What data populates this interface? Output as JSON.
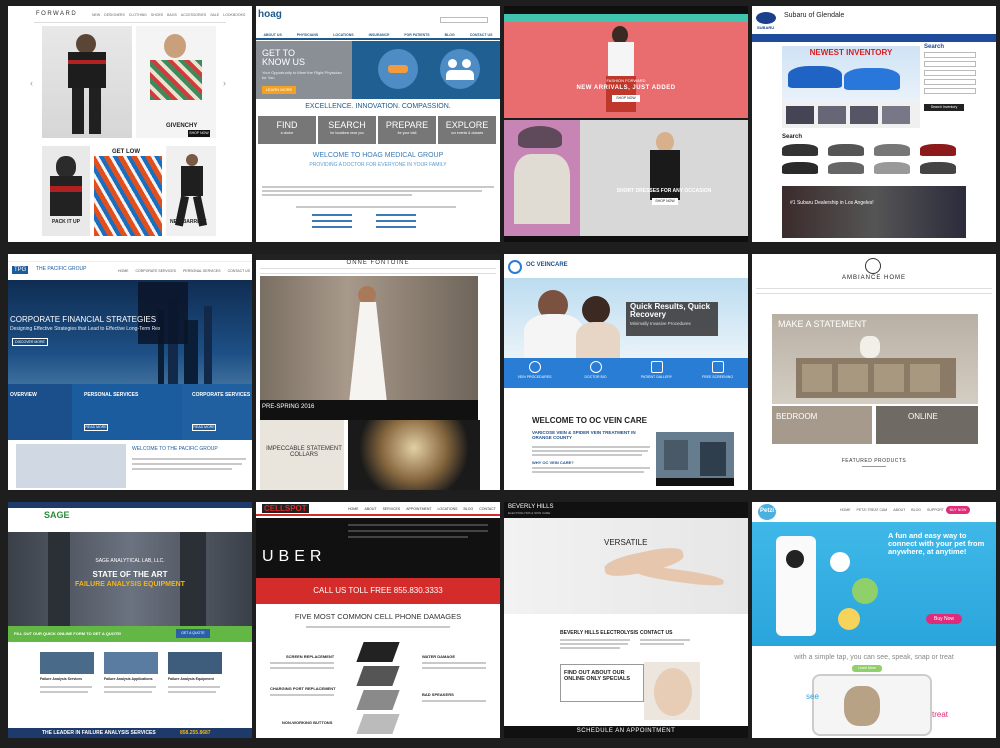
{
  "tiles": {
    "forward": {
      "logo": "FORWARD",
      "nav": [
        "NEW",
        "DESIGNERS",
        "CLOTHING",
        "SHOES",
        "BAGS",
        "ACCESSORIES",
        "SALE",
        "LOOKBOOKS"
      ],
      "hero_brand": "GIVENCHY",
      "hero_button": "SHOP NOW",
      "get_low": "GET LOW",
      "pack_it_up": "PACK IT UP",
      "neil_barrett": "NEIL BARRETT"
    },
    "hoag": {
      "logo": "hoag",
      "nav": [
        "ABOUT US",
        "PHYSICIANS",
        "LOCATIONS",
        "INSURANCE",
        "FOR PATIENTS",
        "BLOG",
        "CONTACT US"
      ],
      "hero_title": "GET TO KNOW US",
      "hero_sub": "Your Opportunity to Meet the Right Physician for You",
      "learn_more": "LEARN MORE",
      "tagline": "EXCELLENCE. INNOVATION. COMPASSION.",
      "boxes": [
        {
          "title": "FIND",
          "sub": "a doctor"
        },
        {
          "title": "SEARCH",
          "sub": "for locations near you"
        },
        {
          "title": "PREPARE",
          "sub": "for your visit"
        },
        {
          "title": "EXPLORE",
          "sub": "our events & classes"
        }
      ],
      "welcome": "WELCOME TO HOAG MEDICAL GROUP",
      "welcome_sub": "PROVIDING A DOCTOR FOR EVERYONE IN YOUR FAMILY"
    },
    "fashion": {
      "hero_kicker": "FASHION FORWARD",
      "hero_title": "NEW ARRIVALS, JUST ADDED",
      "shop_now": "SHOP NOW",
      "dresses": "SHORT DRESSES FOR ANY OCCASION",
      "shop_now_2": "SHOP NOW"
    },
    "subaru": {
      "brand": "SUBARU",
      "dealer": "Subaru of Glendale",
      "banner": "NEWEST INVENTORY",
      "search_title": "Search",
      "search_label": "Search",
      "search_button": "Search Inventory",
      "promo": "#1 Subaru Dealership in Los Angeles!"
    },
    "pacific": {
      "logo_mark": "TPG",
      "logo_text": "THE PACIFIC GROUP",
      "nav": [
        "HOME",
        "CORPORATE SERVICES",
        "PERSONAL SERVICES",
        "CONTACT US"
      ],
      "hero_title": "CORPORATE FINANCIAL STRATEGIES",
      "hero_sub": "Designing Effective Strategies that Lead to Effective Long-Term Results",
      "discover": "DISCOVER MORE",
      "col1": "OVERVIEW",
      "col2": "PERSONAL SERVICES",
      "col3": "CORPORATE SERVICES",
      "read_more": "READ MORE",
      "welcome": "WELCOME TO THE PACIFIC GROUP"
    },
    "onne": {
      "logo": "ONNE FONTOINE",
      "season": "PRE-SPRING 2016",
      "collars": "IMPECCABLE STATEMENT COLLARS"
    },
    "ocvein": {
      "logo": "OC VEINCARE",
      "hero_title": "Quick Results, Quick Recovery",
      "hero_sub": "Minimally Invasive Procedures",
      "features": [
        "VEIN PROCEDURES",
        "DOCTOR BIO",
        "PATIENT GALLERY",
        "FREE SCREENING"
      ],
      "welcome": "WELCOME TO OC VEIN CARE",
      "sub": "VARICOSE VEIN & SPIDER VEIN TREATMENT IN ORANGE COUNTY",
      "why": "WHY OC VEIN CARE?"
    },
    "ambiance": {
      "logo": "AMBIANCE HOME",
      "hero": "MAKE A STATEMENT",
      "bedroom": "BEDROOM",
      "online": "ONLINE",
      "featured": "FEATURED PRODUCTS"
    },
    "sage": {
      "logo": "SAGE",
      "hero_lab": "SAGE ANALYTICAL LAB, LLC.",
      "hero_title": "STATE OF THE ART",
      "hero_sub": "FAILURE ANALYSIS EQUIPMENT",
      "quote_bar": "FILL OUT OUR QUICK ONLINE FORM TO GET A QUOTE!",
      "quote_btn": "GET A QUOTE",
      "cards": [
        "Failure Analysis Services",
        "Failure Analysis Applications",
        "Failure Analysis Equipment"
      ],
      "footer": "THE LEADER IN FAILURE ANALYSIS SERVICES",
      "phone": "858.255.8687"
    },
    "cellspot": {
      "logo": "CELLSPOT",
      "nav": [
        "HOME",
        "ABOUT",
        "SERVICES",
        "APPOINTMENT",
        "LOCATIONS",
        "BLOG",
        "CONTACT"
      ],
      "uber": "UBER",
      "call": "CALL US TOLL FREE 855.830.3333",
      "damages": "FIVE MOST COMMON CELL PHONE DAMAGES",
      "items": [
        "SCREEN REPLACEMENT",
        "WATER DAMAGE",
        "CHARGING PORT REPLACEMENT",
        "BAD SPEAKERS",
        "NON-WORKING BUTTONS"
      ]
    },
    "beverly": {
      "logo": "BEVERLY HILLS",
      "logo_sub": "ELECTROLYSIS & SKIN CARE",
      "hero": "VERSATILE",
      "section": "BEVERLY HILLS ELECTROLYSIS",
      "contact": "CONTACT US",
      "specials": "FIND OUT ABOUT OUR ONLINE ONLY SPECIALS",
      "appointment": "SCHEDULE AN APPOINTMENT"
    },
    "petzi": {
      "logo": "Petzi",
      "nav": [
        "HOME",
        "PETZI TREAT CAM",
        "ABOUT",
        "BLOG",
        "SUPPORT"
      ],
      "buy_now": "BUY NOW",
      "hero": "A fun and easy way to connect with your pet from anywhere, at anytime!",
      "hero_buy": "Buy Now",
      "simple_tap": "with a simple tap, you can see, speak, snap or treat",
      "learn_more": "Learn More",
      "see": "see",
      "treat": "treat"
    }
  }
}
